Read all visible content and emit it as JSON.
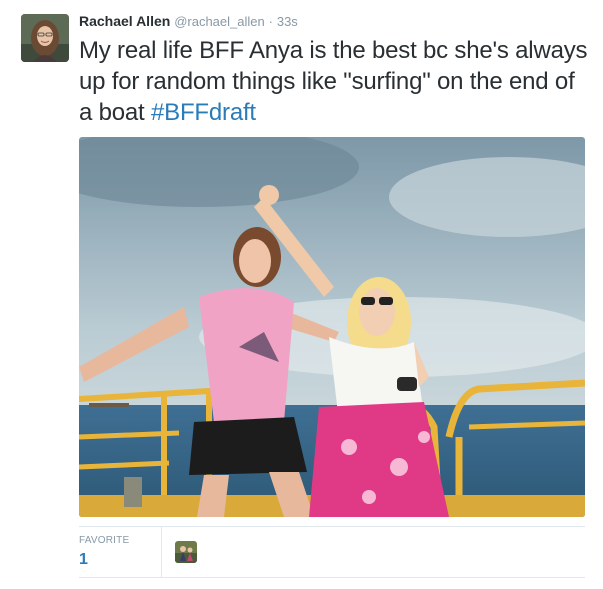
{
  "tweet": {
    "author_name": "Rachael Allen",
    "author_handle": "@rachael_allen",
    "separator": "·",
    "timestamp": "33s",
    "text": "My real life BFF Anya is the best bc she's always up for random things like \"surfing\" on the end of a boat ",
    "hashtag": "#BFFdraft",
    "photo_icon": "photo-of-two-women-on-boat"
  },
  "stats": {
    "favorites_label": "FAVORITE",
    "favorites_count": "1"
  },
  "colors": {
    "link": "#2b7bb9",
    "muted": "#8899a6",
    "text": "#292f33",
    "border": "#e1e8ed"
  }
}
